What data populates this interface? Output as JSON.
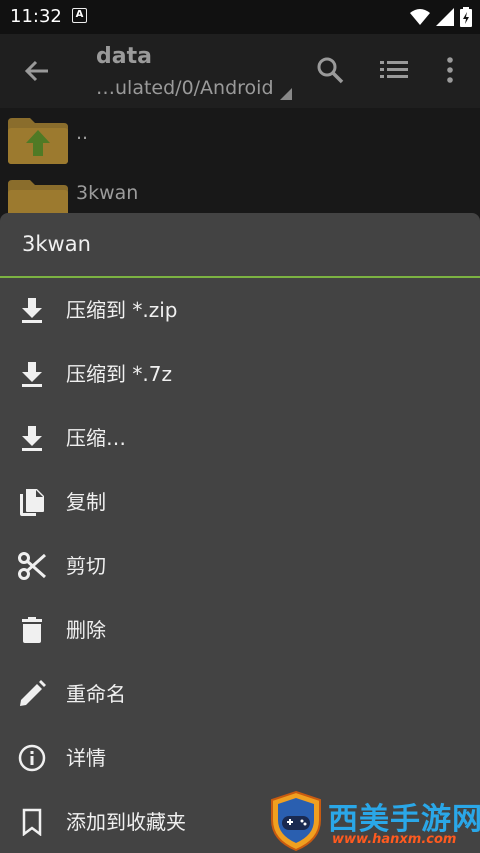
{
  "status_bar": {
    "time": "11:32",
    "notification_letter": "A"
  },
  "app_bar": {
    "title": "data",
    "path": "…ulated/0/Android"
  },
  "files": [
    {
      "name": ".."
    },
    {
      "name": "3kwan"
    }
  ],
  "sheet": {
    "title": "3kwan",
    "accent_color": "#7cb342",
    "items": [
      {
        "label": "压缩到 *.zip",
        "icon": "download-icon"
      },
      {
        "label": "压缩到 *.7z",
        "icon": "download-icon"
      },
      {
        "label": "压缩…",
        "icon": "download-icon"
      },
      {
        "label": "复制",
        "icon": "copy-icon"
      },
      {
        "label": "剪切",
        "icon": "scissors-icon"
      },
      {
        "label": "删除",
        "icon": "trash-icon"
      },
      {
        "label": "重命名",
        "icon": "pencil-icon"
      },
      {
        "label": "详情",
        "icon": "info-icon"
      },
      {
        "label": "添加到收藏夹",
        "icon": "bookmark-icon"
      }
    ]
  },
  "watermark": {
    "text": "西美手游网",
    "url": "www.hanxm.com"
  }
}
